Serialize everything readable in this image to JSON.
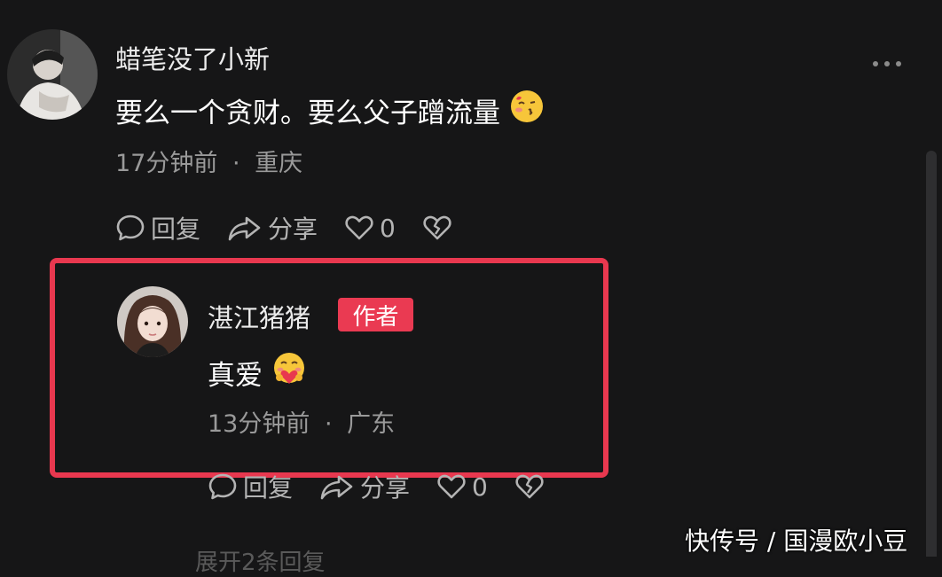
{
  "comment": {
    "username": "蜡笔没了小新",
    "text": "要么一个贪财。要么父子蹭流量",
    "emoji_icon": "blushing-kiss-emoji",
    "time": "17分钟前",
    "separator": "·",
    "location": "重庆",
    "actions": {
      "reply": "回复",
      "share": "分享",
      "like_count": "0"
    }
  },
  "reply": {
    "username": "湛江猪猪",
    "badge": "作者",
    "text": "真爱",
    "emoji_icon": "heart-hug-emoji",
    "time": "13分钟前",
    "separator": "·",
    "location": "广东",
    "actions": {
      "reply": "回复",
      "share": "分享",
      "like_count": "0"
    }
  },
  "expand_label": "展开2条回复",
  "watermark": "快传号 / 国漫欧小豆",
  "colors": {
    "background": "#161617",
    "highlight": "#e8384f",
    "badge": "#ea3a52",
    "meta_text": "#9a9a9a"
  }
}
